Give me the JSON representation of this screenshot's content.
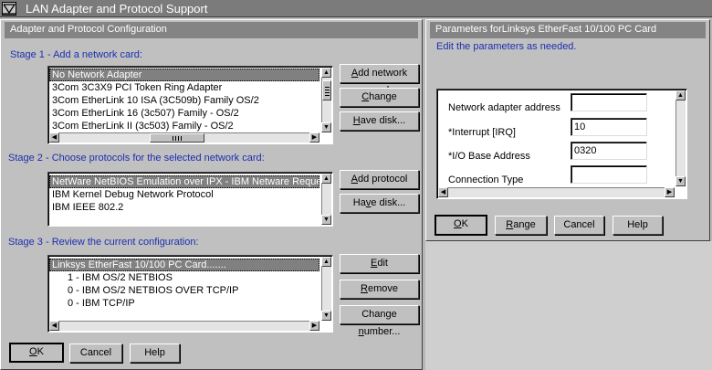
{
  "window": {
    "title": "LAN Adapter and Protocol Support"
  },
  "left_dialog": {
    "title": "Adapter and Protocol Configuration",
    "stage1": {
      "label": "Stage 1 - Add a network card:",
      "items": [
        {
          "label": "No Network Adapter",
          "selected": true
        },
        {
          "label": "3Com 3C3X9 PCI Token Ring Adapter",
          "selected": false
        },
        {
          "label": "3Com EtherLink 10 ISA (3C509b) Family OS/2",
          "selected": false
        },
        {
          "label": "3Com EtherLink 16 (3c507) Family - OS/2",
          "selected": false
        },
        {
          "label": "3Com EtherLink II (3c503) Family - OS/2",
          "selected": false
        }
      ],
      "buttons": {
        "add": {
          "accel": "A",
          "rest": "dd network card"
        },
        "change": {
          "accel": "C",
          "rest": "hange"
        },
        "have_disk": {
          "accel": "H",
          "rest": "ave disk..."
        }
      }
    },
    "stage2": {
      "label": "Stage 2 - Choose protocols for the selected network card:",
      "items": [
        {
          "label": "NetWare NetBIOS Emulation over IPX - IBM Netware Requester",
          "selected": true
        },
        {
          "label": "IBM Kernel Debug Network Protocol",
          "selected": false
        },
        {
          "label": "IBM IEEE 802.2",
          "selected": false
        }
      ],
      "buttons": {
        "add_protocol": {
          "accel": "A",
          "rest": "dd protocol"
        },
        "have_disk": {
          "pre": "Ha",
          "accel": "v",
          "rest": "e disk..."
        }
      }
    },
    "stage3": {
      "label": "Stage 3 - Review the current configuration:",
      "items": [
        {
          "label": "Linksys EtherFast 10/100 PC Card.......",
          "selected": true,
          "indent": 0
        },
        {
          "label": "1 - IBM OS/2 NETBIOS",
          "selected": false,
          "indent": 1
        },
        {
          "label": "0 - IBM OS/2 NETBIOS OVER TCP/IP",
          "selected": false,
          "indent": 1
        },
        {
          "label": "0 - IBM TCP/IP",
          "selected": false,
          "indent": 1
        }
      ],
      "buttons": {
        "edit": {
          "accel": "E",
          "rest": "dit"
        },
        "remove": {
          "accel": "R",
          "rest": "emove"
        },
        "change_number": {
          "pre": "Change ",
          "accel": "n",
          "rest": "umber..."
        }
      }
    },
    "footer": {
      "ok": {
        "accel": "O",
        "rest": "K"
      },
      "cancel": "Cancel",
      "help": "Help"
    }
  },
  "right_dialog": {
    "title": "Parameters forLinksys EtherFast 10/100 PC Card",
    "instruction": "Edit the parameters as needed.",
    "params": [
      {
        "label": "Network adapter address",
        "value": ""
      },
      {
        "label": "*Interrupt [IRQ]",
        "value": "10"
      },
      {
        "label": "*I/O Base Address",
        "value": "0320"
      },
      {
        "label": "Connection Type",
        "value": ""
      }
    ],
    "footer": {
      "ok": {
        "accel": "O",
        "rest": "K"
      },
      "range": {
        "accel": "R",
        "rest": "ange"
      },
      "cancel": "Cancel",
      "help": "Help"
    }
  }
}
